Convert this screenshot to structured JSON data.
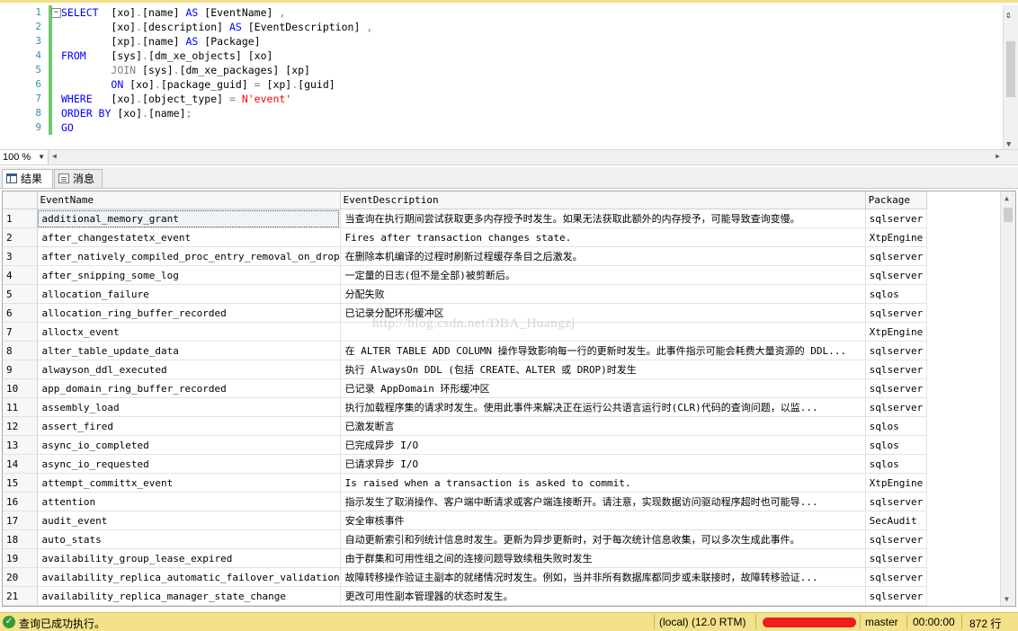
{
  "editor": {
    "line_numbers": [
      "1",
      "2",
      "3",
      "4",
      "5",
      "6",
      "7",
      "8",
      "9"
    ],
    "lines": [
      [
        {
          "t": "SELECT",
          "c": "kw"
        },
        {
          "t": "  [xo]",
          "c": "bk"
        },
        {
          "t": ".",
          "c": "gr"
        },
        {
          "t": "[name] ",
          "c": "bk"
        },
        {
          "t": "AS",
          "c": "kw"
        },
        {
          "t": " [EventName] ",
          "c": "bk"
        },
        {
          "t": ",",
          "c": "gr"
        }
      ],
      [
        {
          "t": "        [xo]",
          "c": "bk"
        },
        {
          "t": ".",
          "c": "gr"
        },
        {
          "t": "[description] ",
          "c": "bk"
        },
        {
          "t": "AS",
          "c": "kw"
        },
        {
          "t": " [EventDescription] ",
          "c": "bk"
        },
        {
          "t": ",",
          "c": "gr"
        }
      ],
      [
        {
          "t": "        [xp]",
          "c": "bk"
        },
        {
          "t": ".",
          "c": "gr"
        },
        {
          "t": "[name] ",
          "c": "bk"
        },
        {
          "t": "AS",
          "c": "kw"
        },
        {
          "t": " [Package]",
          "c": "bk"
        }
      ],
      [
        {
          "t": "FROM",
          "c": "kw"
        },
        {
          "t": "    [sys]",
          "c": "bk"
        },
        {
          "t": ".",
          "c": "gr"
        },
        {
          "t": "[dm_xe_objects] [xo]",
          "c": "bk"
        }
      ],
      [
        {
          "t": "        ",
          "c": "bk"
        },
        {
          "t": "JOIN",
          "c": "gr"
        },
        {
          "t": " [sys]",
          "c": "bk"
        },
        {
          "t": ".",
          "c": "gr"
        },
        {
          "t": "[dm_xe_packages] [xp]",
          "c": "bk"
        }
      ],
      [
        {
          "t": "        ",
          "c": "bk"
        },
        {
          "t": "ON",
          "c": "kw"
        },
        {
          "t": " [xo]",
          "c": "bk"
        },
        {
          "t": ".",
          "c": "gr"
        },
        {
          "t": "[package_guid] ",
          "c": "bk"
        },
        {
          "t": "=",
          "c": "gr"
        },
        {
          "t": " [xp]",
          "c": "bk"
        },
        {
          "t": ".",
          "c": "gr"
        },
        {
          "t": "[guid]",
          "c": "bk"
        }
      ],
      [
        {
          "t": "WHERE",
          "c": "kw"
        },
        {
          "t": "   [xo]",
          "c": "bk"
        },
        {
          "t": ".",
          "c": "gr"
        },
        {
          "t": "[object_type] ",
          "c": "bk"
        },
        {
          "t": "=",
          "c": "gr"
        },
        {
          "t": " N'event'",
          "c": "st"
        }
      ],
      [
        {
          "t": "ORDER BY",
          "c": "kw"
        },
        {
          "t": " [xo]",
          "c": "bk"
        },
        {
          "t": ".",
          "c": "gr"
        },
        {
          "t": "[name]",
          "c": "bk"
        },
        {
          "t": ";",
          "c": "gr"
        }
      ],
      [
        {
          "t": "GO",
          "c": "kw"
        }
      ]
    ]
  },
  "zoom": {
    "value": "100 %"
  },
  "tabs": {
    "results": "结果",
    "messages": "消息"
  },
  "grid": {
    "columns": [
      "EventName",
      "EventDescription",
      "Package"
    ],
    "rows": [
      [
        "1",
        "additional_memory_grant",
        "当查询在执行期间尝试获取更多内存授予时发生。如果无法获取此额外的内存授予，可能导致查询变慢。",
        "sqlserver"
      ],
      [
        "2",
        "after_changestatetx_event",
        "Fires after transaction changes state.",
        "XtpEngine"
      ],
      [
        "3",
        "after_natively_compiled_proc_entry_removal_on_drop",
        "在删除本机编译的过程时刷新过程缓存条目之后激发。",
        "sqlserver"
      ],
      [
        "4",
        "after_snipping_some_log",
        "一定量的日志(但不是全部)被剪断后。",
        "sqlserver"
      ],
      [
        "5",
        "allocation_failure",
        "分配失败",
        "sqlos"
      ],
      [
        "6",
        "allocation_ring_buffer_recorded",
        "已记录分配环形缓冲区",
        "sqlserver"
      ],
      [
        "7",
        "alloctx_event",
        "",
        "XtpEngine"
      ],
      [
        "8",
        "alter_table_update_data",
        "在 ALTER TABLE ADD COLUMN 操作导致影响每一行的更新时发生。此事件指示可能会耗费大量资源的 DDL...",
        "sqlserver"
      ],
      [
        "9",
        "alwayson_ddl_executed",
        "执行 AlwaysOn DDL (包括 CREATE、ALTER 或 DROP)时发生",
        "sqlserver"
      ],
      [
        "10",
        "app_domain_ring_buffer_recorded",
        "已记录 AppDomain 环形缓冲区",
        "sqlserver"
      ],
      [
        "11",
        "assembly_load",
        "执行加载程序集的请求时发生。使用此事件来解决正在运行公共语言运行时(CLR)代码的查询问题，以监...",
        "sqlserver"
      ],
      [
        "12",
        "assert_fired",
        "已激发断言",
        "sqlos"
      ],
      [
        "13",
        "async_io_completed",
        "已完成异步 I/O",
        "sqlos"
      ],
      [
        "14",
        "async_io_requested",
        "已请求异步 I/O",
        "sqlos"
      ],
      [
        "15",
        "attempt_committx_event",
        "Is raised when a transaction is asked to commit.",
        "XtpEngine"
      ],
      [
        "16",
        "attention",
        "指示发生了取消操作、客户端中断请求或客户端连接断开。请注意，实现数据访问驱动程序超时也可能导...",
        "sqlserver"
      ],
      [
        "17",
        "audit_event",
        "安全审核事件",
        "SecAudit"
      ],
      [
        "18",
        "auto_stats",
        "自动更新索引和列统计信息时发生。更新为异步更新时，对于每次统计信息收集，可以多次生成此事件。",
        "sqlserver"
      ],
      [
        "19",
        "availability_group_lease_expired",
        "由于群集和可用性组之间的连接问题导致续租失败时发生",
        "sqlserver"
      ],
      [
        "20",
        "availability_replica_automatic_failover_validation",
        "故障转移操作验证主副本的就绪情况时发生。例如，当并非所有数据库都同步或未联接时，故障转移验证...",
        "sqlserver"
      ],
      [
        "21",
        "availability_replica_manager_state_change",
        "更改可用性副本管理器的状态时发生。",
        "sqlserver"
      ]
    ]
  },
  "watermark": "http://blog.csdn.net/DBA_Huangzj",
  "status": {
    "message": "查询已成功执行。",
    "server": "(local) (12.0 RTM)",
    "database": "master",
    "elapsed": "00:00:00",
    "row_count": "872 行"
  }
}
